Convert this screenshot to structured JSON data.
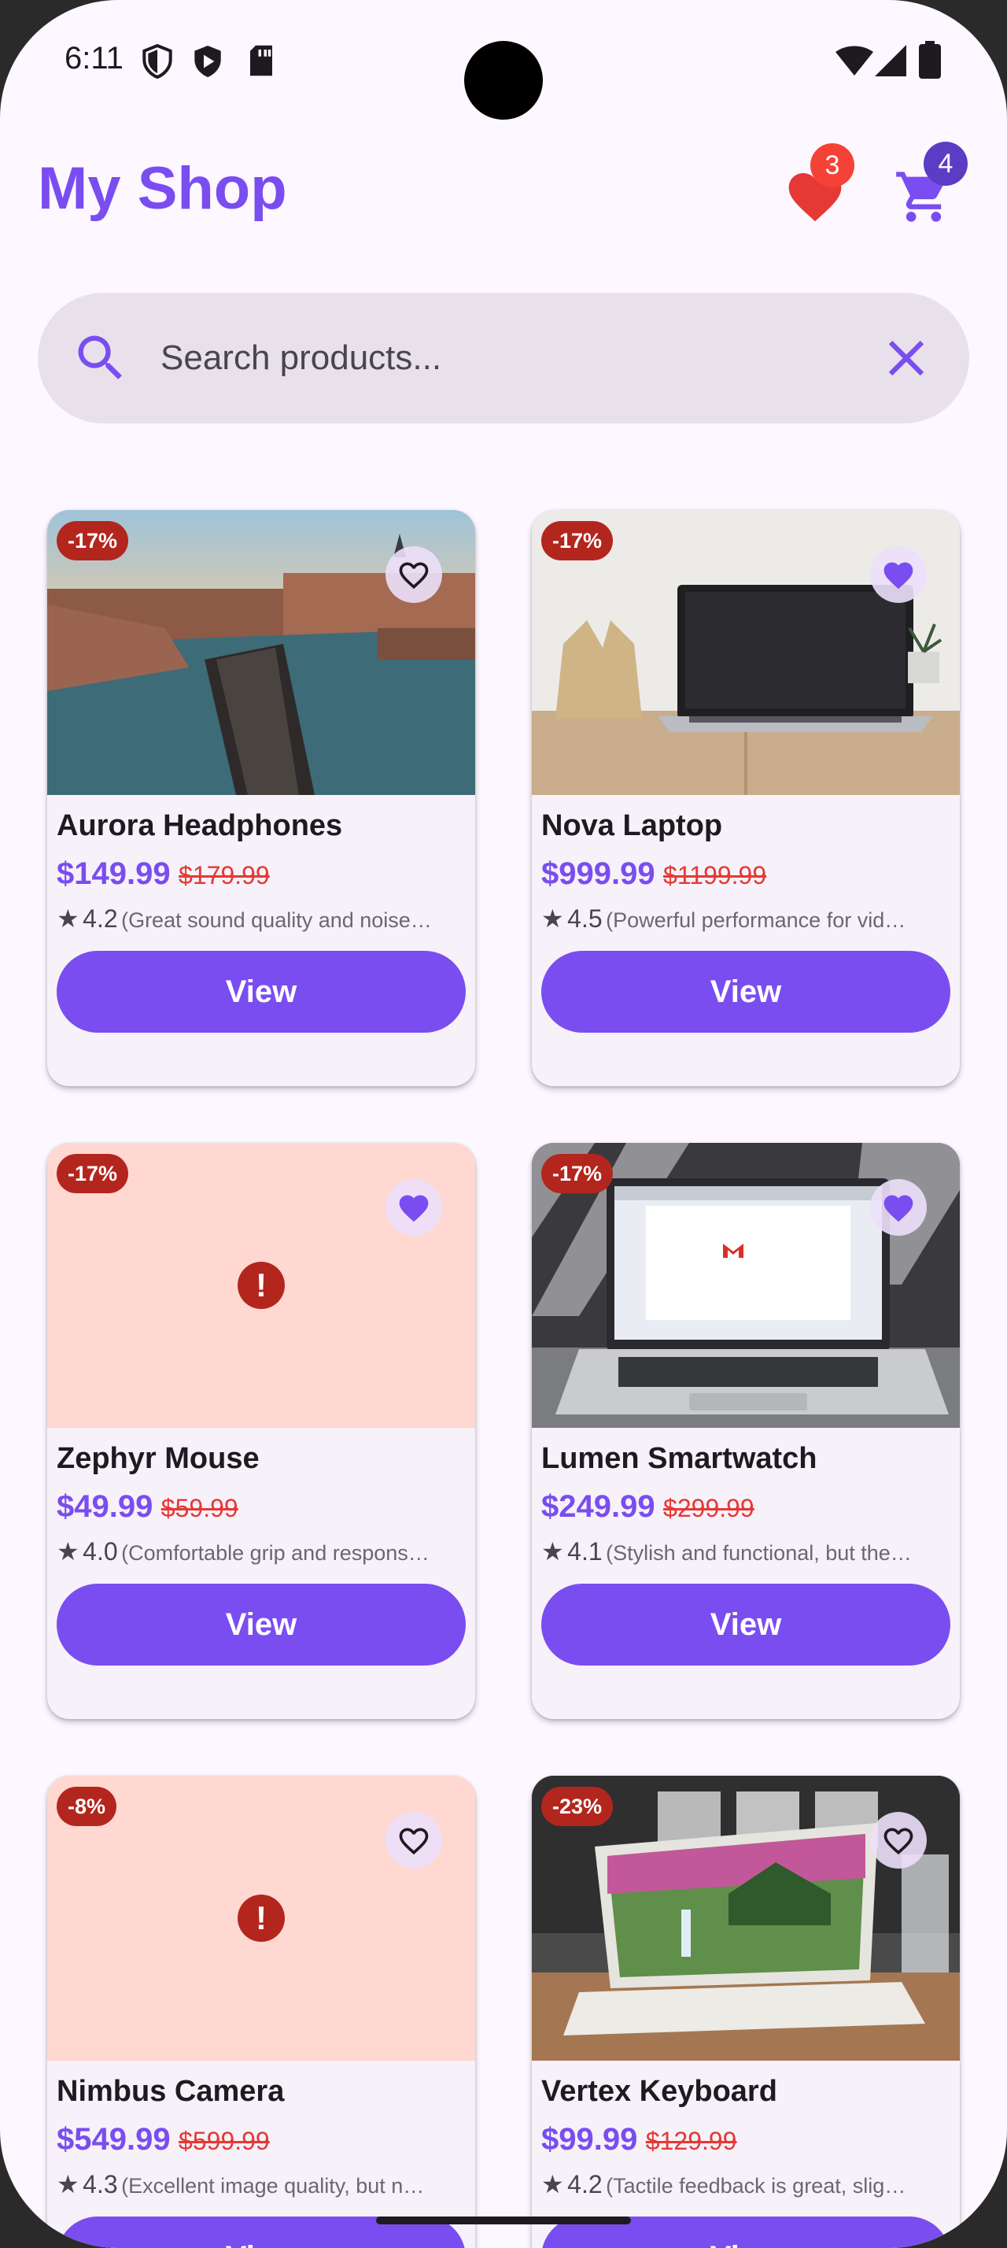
{
  "status_bar": {
    "time": "6:11"
  },
  "header": {
    "title": "My Shop",
    "favorites_count": "3",
    "cart_count": "4"
  },
  "search": {
    "placeholder": "Search products..."
  },
  "colors": {
    "primary": "#7a4df0",
    "discount": "#b3261e",
    "old_price": "#e53935",
    "card_bg": "#f7f1f9",
    "page_bg": "#fdf7ff"
  },
  "products": [
    {
      "name": "Aurora Headphones",
      "price": "$149.99",
      "old_price": "$179.99",
      "discount": "-17%",
      "rating": "4.2",
      "review": "(Great sound quality and noise…",
      "view_label": "View",
      "favorited": false,
      "image": "city-river-photo"
    },
    {
      "name": "Nova Laptop",
      "price": "$999.99",
      "old_price": "$1199.99",
      "discount": "-17%",
      "rating": "4.5",
      "review": "(Powerful performance for vid…",
      "view_label": "View",
      "favorited": true,
      "image": "laptop-desk-photo"
    },
    {
      "name": "Zephyr Mouse",
      "price": "$49.99",
      "old_price": "$59.99",
      "discount": "-17%",
      "rating": "4.0",
      "review": "(Comfortable grip and respons…",
      "view_label": "View",
      "favorited": true,
      "image": "error-icon"
    },
    {
      "name": "Lumen Smartwatch",
      "price": "$249.99",
      "old_price": "$299.99",
      "discount": "-17%",
      "rating": "4.1",
      "review": "(Stylish and functional, but the…",
      "view_label": "View",
      "favorited": true,
      "image": "laptop-email-photo"
    },
    {
      "name": "Nimbus Camera",
      "price": "$549.99",
      "old_price": "$599.99",
      "discount": "-8%",
      "rating": "4.3",
      "review": "(Excellent image quality, but n…",
      "view_label": "View",
      "favorited": false,
      "image": "error-icon"
    },
    {
      "name": "Vertex Keyboard",
      "price": "$99.99",
      "old_price": "$129.99",
      "discount": "-23%",
      "rating": "4.2",
      "review": "(Tactile feedback is great, slig…",
      "view_label": "View",
      "favorited": false,
      "image": "laptop-landscape-photo"
    }
  ]
}
